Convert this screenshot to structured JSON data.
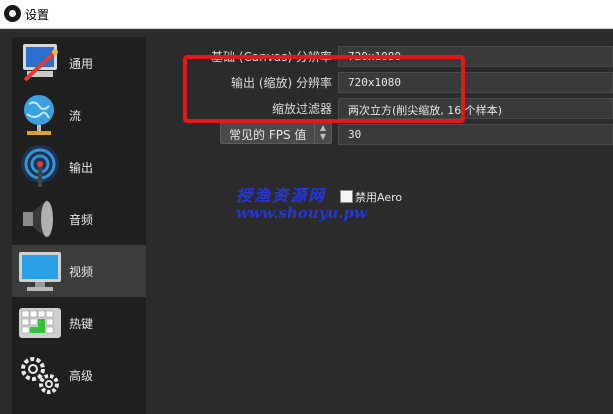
{
  "window": {
    "title": "设置"
  },
  "sidebar": {
    "items": [
      {
        "label": "通用",
        "icon": "general-computer-icon"
      },
      {
        "label": "流",
        "icon": "globe-stream-icon"
      },
      {
        "label": "输出",
        "icon": "output-broadcast-icon"
      },
      {
        "label": "音频",
        "icon": "speaker-icon"
      },
      {
        "label": "视频",
        "icon": "monitor-icon",
        "active": true
      },
      {
        "label": "热键",
        "icon": "keyboard-icon"
      },
      {
        "label": "高级",
        "icon": "gears-icon"
      }
    ]
  },
  "video": {
    "base_resolution_label": "基础 (Canvas) 分辨率",
    "base_resolution_value": "720x1080",
    "output_resolution_label": "输出 (缩放) 分辨率",
    "output_resolution_value": "720x1080",
    "downscale_filter_label": "缩放过滤器",
    "downscale_filter_value": "两次立方(削尖缩放, 16 个样本)",
    "fps_type": "常见的 FPS 值",
    "fps_value": "30",
    "disable_aero_label": "禁用Aero",
    "disable_aero_checked": false
  },
  "watermark": {
    "line1": "授渔资源网",
    "line2": "www.shouyu.pw"
  },
  "colors": {
    "highlight": "#e01a1a",
    "watermark": "#2436d6",
    "background": "#2b2b2b",
    "sidebar": "#1f1f1f",
    "active_item": "#3c3c3c"
  }
}
